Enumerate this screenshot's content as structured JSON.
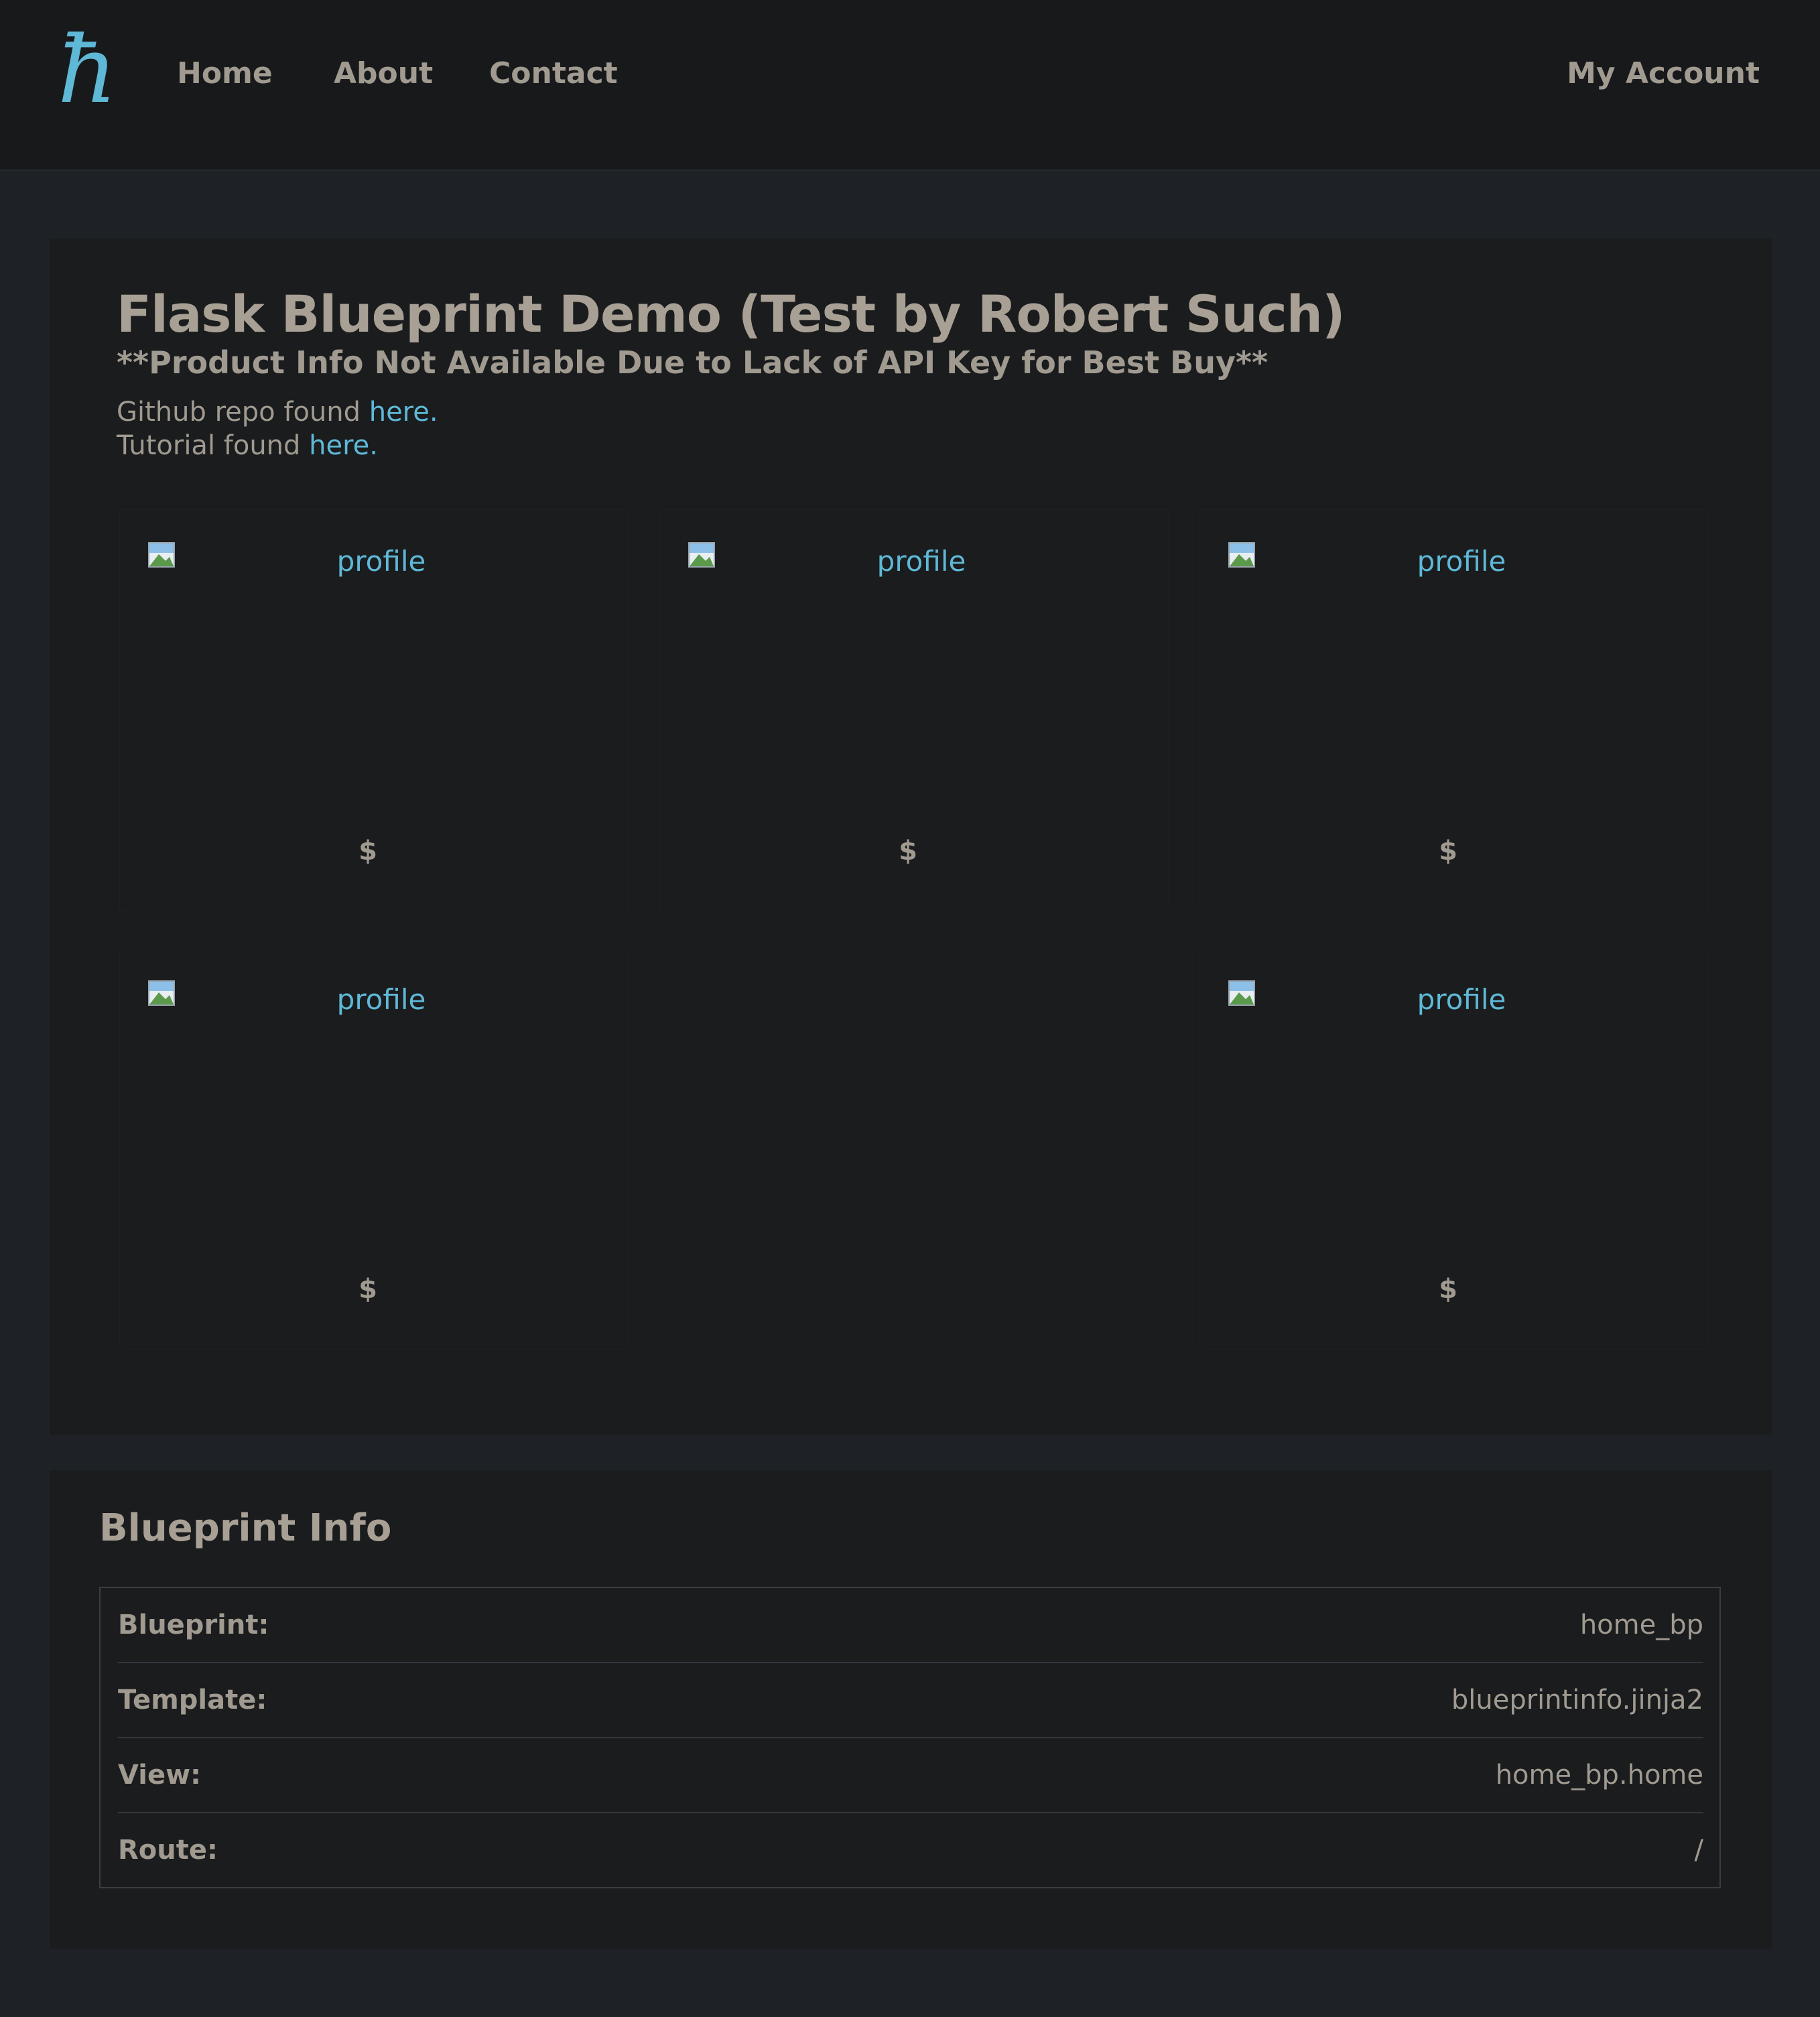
{
  "navbar": {
    "logo_glyph": "ħ",
    "links": [
      "Home",
      "About",
      "Contact"
    ],
    "account": "My Account",
    "accent_color": "#5fb8d6"
  },
  "main": {
    "title": "Flask Blueprint Demo (Test by Robert Such)",
    "subtitle": "**Product Info Not Available Due to Lack of API Key for Best Buy**",
    "github_text": "Github repo found ",
    "github_link": "here.",
    "tutorial_text": "Tutorial found ",
    "tutorial_link": "here.",
    "products": [
      {
        "alt": "profile",
        "price": "$"
      },
      {
        "alt": "profile",
        "price": "$"
      },
      {
        "alt": "profile",
        "price": "$"
      },
      {
        "alt": "profile",
        "price": "$"
      },
      {
        "alt": "profile",
        "price": "$"
      }
    ]
  },
  "blueprint_info": {
    "title": "Blueprint Info",
    "rows": [
      {
        "label": "Blueprint:",
        "value": "home_bp"
      },
      {
        "label": "Template:",
        "value": "blueprintinfo.jinja2"
      },
      {
        "label": "View:",
        "value": "home_bp.home"
      },
      {
        "label": "Route:",
        "value": "/"
      }
    ]
  }
}
